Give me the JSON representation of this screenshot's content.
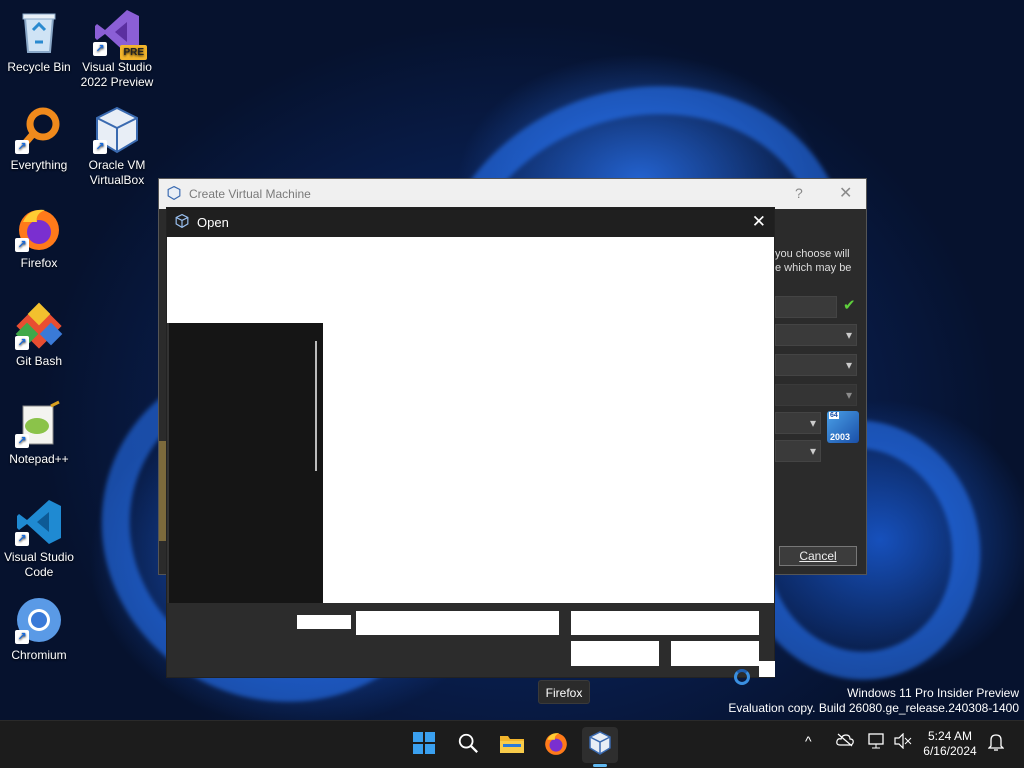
{
  "desktop": {
    "icons": [
      {
        "label": "Recycle Bin",
        "icon": "recycle-bin-icon"
      },
      {
        "label": "Visual Studio 2022 Preview",
        "icon": "visual-studio-icon",
        "badge": "PRE"
      },
      {
        "label": "Everything",
        "icon": "everything-search-icon"
      },
      {
        "label": "Oracle VM VirtualBox",
        "icon": "virtualbox-icon"
      },
      {
        "label": "Firefox",
        "icon": "firefox-icon"
      },
      {
        "label": "Git Bash",
        "icon": "git-bash-icon"
      },
      {
        "label": "Notepad++",
        "icon": "notepad-plus-plus-icon"
      },
      {
        "label": "Visual Studio Code",
        "icon": "vscode-icon"
      },
      {
        "label": "Chromium",
        "icon": "chromium-icon"
      }
    ]
  },
  "create_vm_dialog": {
    "title": "Create Virtual Machine",
    "help_glyph": "?",
    "close_glyph": "✕",
    "partial_text_line1": "you choose will",
    "partial_text_line2": "e which may be",
    "cancel_label": "Cancel",
    "os_badge_bits": "64",
    "os_badge_year": "2003",
    "valid_check": "✔"
  },
  "open_dialog": {
    "title": "Open",
    "close_glyph": "✕"
  },
  "tooltip": {
    "text": "Firefox"
  },
  "watermark": {
    "line1": "Windows 11 Pro Insider Preview",
    "line2": "Evaluation copy. Build 26080.ge_release.240308-1400"
  },
  "taskbar": {
    "apps": [
      "start-button",
      "search-button",
      "file-explorer",
      "firefox",
      "virtualbox"
    ],
    "tray": {
      "chevron": "^",
      "time": "5:24 AM",
      "date": "6/16/2024"
    }
  },
  "colors": {
    "accent": "#60b8f0",
    "taskbar": "#1c1c1c",
    "dialog_dark": "#2b2b2b"
  }
}
